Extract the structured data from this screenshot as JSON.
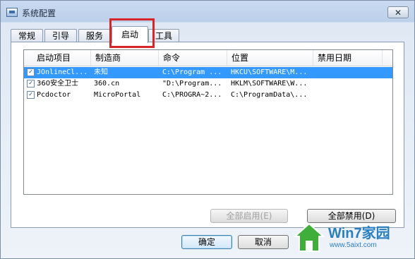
{
  "window": {
    "title": "系统配置",
    "close_label": "✕"
  },
  "tabs": [
    {
      "label": "常规",
      "active": false
    },
    {
      "label": "引导",
      "active": false
    },
    {
      "label": "服务",
      "active": false
    },
    {
      "label": "启动",
      "active": true
    },
    {
      "label": "工具",
      "active": false
    }
  ],
  "table": {
    "columns": [
      "启动项目",
      "制造商",
      "命令",
      "位置",
      "禁用日期"
    ],
    "rows": [
      {
        "checked": true,
        "item": "JOnlineCl...",
        "maker": "未知",
        "command": "C:\\Program ...",
        "location": "HKCU\\SOFTWARE\\M...",
        "disabled_date": "",
        "selected": true
      },
      {
        "checked": true,
        "item": "360安全卫士",
        "maker": "360.cn",
        "command": "\"D:\\Program...",
        "location": "HKLM\\SOFTWARE\\W...",
        "disabled_date": "",
        "selected": false
      },
      {
        "checked": true,
        "item": "Pcdoctor",
        "maker": "MicroPortal",
        "command": "C:\\PROGRA~2...",
        "location": "C:\\ProgramData\\...",
        "disabled_date": "",
        "selected": false
      }
    ]
  },
  "buttons": {
    "enable_all": "全部启用(E)",
    "disable_all": "全部禁用(D)",
    "ok": "确定",
    "cancel": "取消"
  },
  "watermark": {
    "brand": "Win7家园",
    "url": "www.5aixt.com"
  },
  "colors": {
    "selection": "#3399ff",
    "highlight": "#d8252a",
    "accent": "#2a7fc0"
  }
}
